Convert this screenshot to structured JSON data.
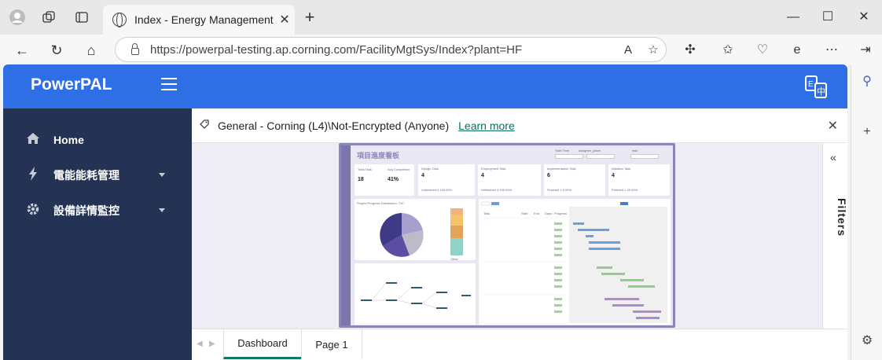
{
  "browser": {
    "tab_title": "Index - Energy Management Syste",
    "url": "https://powerpal-testing.ap.corning.com/FacilityMgtSys/Index?plant=HF"
  },
  "app": {
    "brand": "PowerPAL",
    "sidebar": {
      "items": [
        {
          "label": "Home",
          "icon": "home-icon"
        },
        {
          "label": "電能能耗管理",
          "icon": "bolt-icon"
        },
        {
          "label": "設備詳情監控",
          "icon": "gear-icon"
        }
      ]
    },
    "banner": {
      "text": "General - Corning (L4)\\Not-Encrypted (Anyone)",
      "link": "Learn more"
    },
    "filters_label": "Filters",
    "pages": [
      "Dashboard",
      "Page 1"
    ],
    "report": {
      "title": "項目進度看板",
      "filter_labels": [
        "Start Time",
        "assignee_place",
        "task"
      ],
      "kpis": [
        {
          "label": "Total Task",
          "value": "18"
        },
        {
          "label": "Avg Completion",
          "value": "41%"
        },
        {
          "label": "Design Task",
          "value": "4",
          "status": "Unfinished 4 100.00%"
        },
        {
          "label": "Employment Task",
          "value": "4",
          "status": "Unfinished 4 100.00%"
        },
        {
          "label": "Implementation Task",
          "value": "6",
          "status": "Finished 1 6.00%"
        },
        {
          "label": "Initiation Task",
          "value": "4",
          "status": "Finished 1 25.00%"
        }
      ],
      "pie_title": "Project Progress Distribution（%）",
      "gantt_cols": [
        "Task",
        "Start",
        "End",
        "Days",
        "Progress"
      ],
      "others_label": "Other"
    },
    "colors": {
      "header": "#2f6fe5",
      "sidebar": "#243253",
      "accent": "#0f7a5f"
    }
  }
}
